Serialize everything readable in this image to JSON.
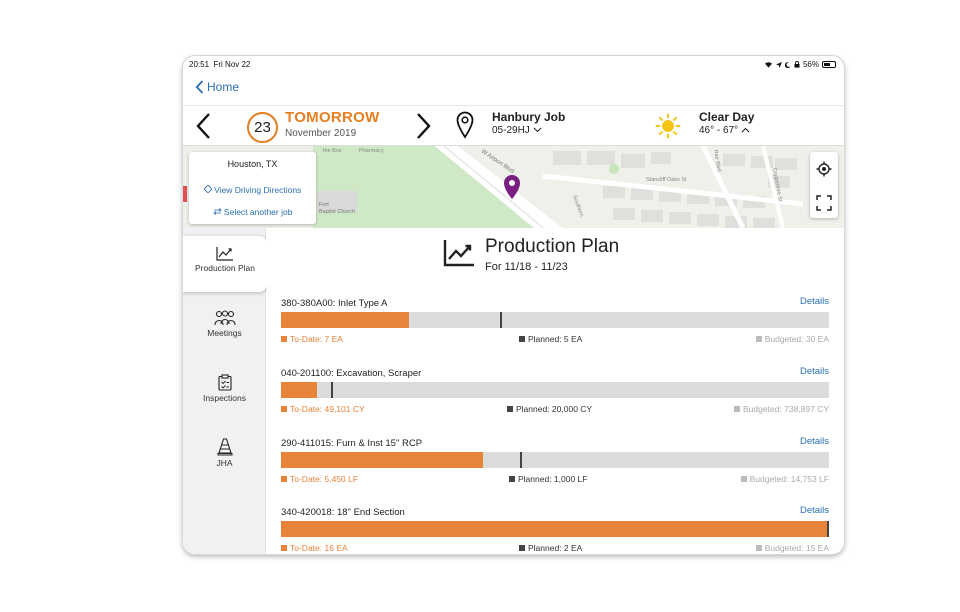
{
  "status_bar": {
    "time": "20:51",
    "date": "Fri Nov 22",
    "battery": "56%"
  },
  "nav": {
    "back_label": "Home"
  },
  "header": {
    "day_number": "23",
    "day_label": "TOMORROW",
    "month_label": "November 2019",
    "job_name": "Hanbury Job",
    "job_code": "05-29HJ",
    "weather_name": "Clear Day",
    "weather_temp": "46° - 67°"
  },
  "map": {
    "city": "Houston, TX",
    "directions_label": "View Driving Directions",
    "select_job_label": "Select another job",
    "street_labels": [
      "W Airport Blvd",
      "Stancliff Oaks St",
      "Southern",
      "Coppertree St",
      "Rae Blvd",
      "Pharmacy",
      "the Box",
      "Baptist Church",
      "Fort"
    ]
  },
  "sidebar": {
    "items": [
      {
        "label": "Production Plan",
        "icon": "trend-chart-icon",
        "active": true
      },
      {
        "label": "Meetings",
        "icon": "people-icon",
        "active": false
      },
      {
        "label": "Inspections",
        "icon": "clipboard-icon",
        "active": false
      },
      {
        "label": "JHA",
        "icon": "cone-icon",
        "active": false
      }
    ]
  },
  "production_plan": {
    "title": "Production Plan",
    "subtitle": "For 11/18 - 11/23",
    "details_label": "Details",
    "colors": {
      "todate": "#e8833a",
      "planned": "#444444",
      "budgeted": "#bbbbbb",
      "track": "#dcdcdc"
    },
    "items": [
      {
        "name": "380-380A00: Inlet Type A",
        "todate": "To-Date: 7 EA",
        "planned": "Planned: 5 EA",
        "budgeted": "Budgeted: 30 EA",
        "fill_fraction": 0.233,
        "planned_fraction": 0.4
      },
      {
        "name": "040-201100: Excavation, Scraper",
        "todate": "To-Date: 49,101 CY",
        "planned": "Planned: 20,000 CY",
        "budgeted": "Budgeted: 738,897 CY",
        "fill_fraction": 0.066,
        "planned_fraction": 0.092
      },
      {
        "name": "290-411015: Furn & Inst 15\" RCP",
        "todate": "To-Date: 5,450 LF",
        "planned": "Planned: 1,000 LF",
        "budgeted": "Budgeted: 14,753 LF",
        "fill_fraction": 0.369,
        "planned_fraction": 0.437
      },
      {
        "name": "340-420018: 18\" End Section",
        "todate": "To-Date: 16 EA",
        "planned": "Planned: 2 EA",
        "budgeted": "Budgeted: 15 EA",
        "fill_fraction": 1.0,
        "planned_fraction": 0.997
      }
    ]
  }
}
